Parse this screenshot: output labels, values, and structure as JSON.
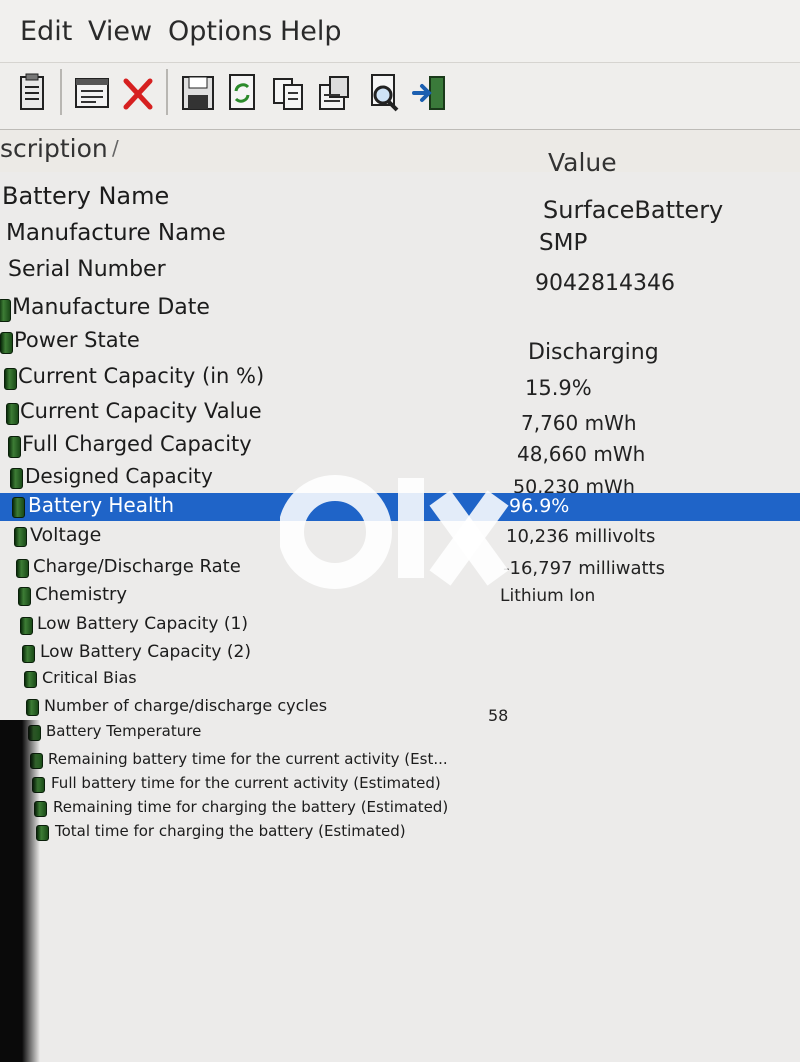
{
  "menu": [
    "Edit",
    "View",
    "Options",
    "Help"
  ],
  "toolbar": {
    "icons": [
      "properties-icon",
      "html-report-icon",
      "delete-icon",
      "save-icon",
      "refresh-icon",
      "copy-icon",
      "properties-sheet-icon",
      "find-icon",
      "exit-icon"
    ]
  },
  "columns": {
    "description": "scription",
    "value": "Value"
  },
  "rows": [
    {
      "label": "Battery Name",
      "value": "SurfaceBattery"
    },
    {
      "label": "Manufacture Name",
      "value": "SMP"
    },
    {
      "label": "Serial Number",
      "value": "9042814346"
    },
    {
      "label": "Manufacture Date",
      "value": ""
    },
    {
      "label": "Power State",
      "value": "Discharging"
    },
    {
      "label": "Current Capacity (in %)",
      "value": "15.9%"
    },
    {
      "label": "Current Capacity Value",
      "value": "7,760 mWh"
    },
    {
      "label": "Full Charged Capacity",
      "value": "48,660 mWh"
    },
    {
      "label": "Designed Capacity",
      "value": "50,230 mWh"
    },
    {
      "label": "Battery Health",
      "value": "96.9%"
    },
    {
      "label": "Voltage",
      "value": "10,236 millivolts"
    },
    {
      "label": "Charge/Discharge Rate",
      "value": "-16,797 milliwatts"
    },
    {
      "label": "Chemistry",
      "value": "Lithium Ion"
    },
    {
      "label": "Low Battery Capacity (1)",
      "value": ""
    },
    {
      "label": "Low Battery Capacity (2)",
      "value": ""
    },
    {
      "label": "Critical Bias",
      "value": ""
    },
    {
      "label": "Number of charge/discharge cycles",
      "value": "58"
    },
    {
      "label": "Battery Temperature",
      "value": ""
    },
    {
      "label": "Remaining battery time for the current activity (Est...",
      "value": ""
    },
    {
      "label": "Full battery time for the current activity (Estimated)",
      "value": ""
    },
    {
      "label": "Remaining time for charging the battery (Estimated)",
      "value": ""
    },
    {
      "label": "Total  time for charging the battery (Estimated)",
      "value": ""
    }
  ],
  "watermark": "olx",
  "colors": {
    "selection": "#1f64c8",
    "battery_icon": "#2e6b28"
  }
}
